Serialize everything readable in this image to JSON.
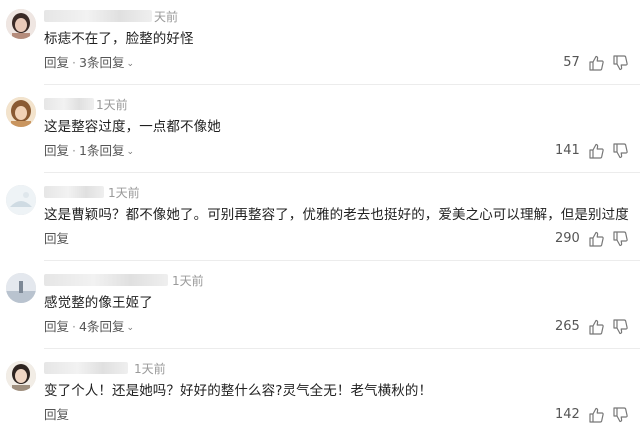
{
  "comments": [
    {
      "time": "天前",
      "text": "标痣不在了，脸整的好怪",
      "reply_label": "回复",
      "sep": "·",
      "replies_label": "3条回复",
      "likes": "57",
      "avatar_color": "#c9b6b0"
    },
    {
      "time": "1天前",
      "text": "这是整容过度，一点都不像她",
      "reply_label": "回复",
      "sep": "·",
      "replies_label": "1条回复",
      "likes": "141",
      "avatar_color": "#d8b48c"
    },
    {
      "time": "1天前",
      "text": "这是曹颖吗？都不像她了。可别再整容了，优雅的老去也挺好的，爱美之心可以理解，但是别过度",
      "reply_label": "回复",
      "likes": "290",
      "avatar_color": "#e8eef2"
    },
    {
      "time": "1天前",
      "text": "感觉整的像王姬了",
      "reply_label": "回复",
      "sep": "·",
      "replies_label": "4条回复",
      "likes": "265",
      "avatar_color": "#d6dbe3"
    },
    {
      "time": "1天前",
      "text": "变了个人！还是她吗？好好的整什么容?灵气全无！老气横秋的！",
      "reply_label": "回复",
      "likes": "142",
      "avatar_color": "#cfc5b8"
    }
  ],
  "icons": {
    "like": "thumbs-up-icon",
    "dislike": "thumbs-down-icon",
    "expand": "chevron-down-icon"
  }
}
